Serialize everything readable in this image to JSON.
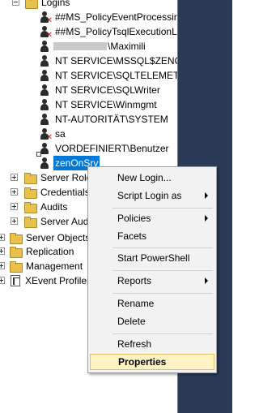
{
  "tree": {
    "logins_folder": "Logins",
    "logins": [
      "##MS_PolicyEventProcessin",
      "##MS_PolicyTsqlExecutionL",
      "\\Maximili",
      "NT SERVICE\\MSSQL$ZENON",
      "NT SERVICE\\SQLTELEMETRY",
      "NT SERVICE\\SQLWriter",
      "NT SERVICE\\Winmgmt",
      "NT-AUTORITÄT\\SYSTEM",
      "sa",
      "VORDEFINIERT\\Benutzer",
      "zenOnSrv"
    ],
    "security_children": [
      "Server Role",
      "Credentials",
      "Audits",
      "Server Audi"
    ],
    "server_nodes": [
      "Server Objects",
      "Replication",
      "Management",
      "XEvent Profiler"
    ]
  },
  "context_menu": {
    "items": {
      "new_login": "New Login...",
      "script_login_as": "Script Login as",
      "policies": "Policies",
      "facets": "Facets",
      "start_powershell": "Start PowerShell",
      "reports": "Reports",
      "rename": "Rename",
      "delete": "Delete",
      "refresh": "Refresh",
      "properties": "Properties"
    },
    "highlighted": "properties"
  }
}
